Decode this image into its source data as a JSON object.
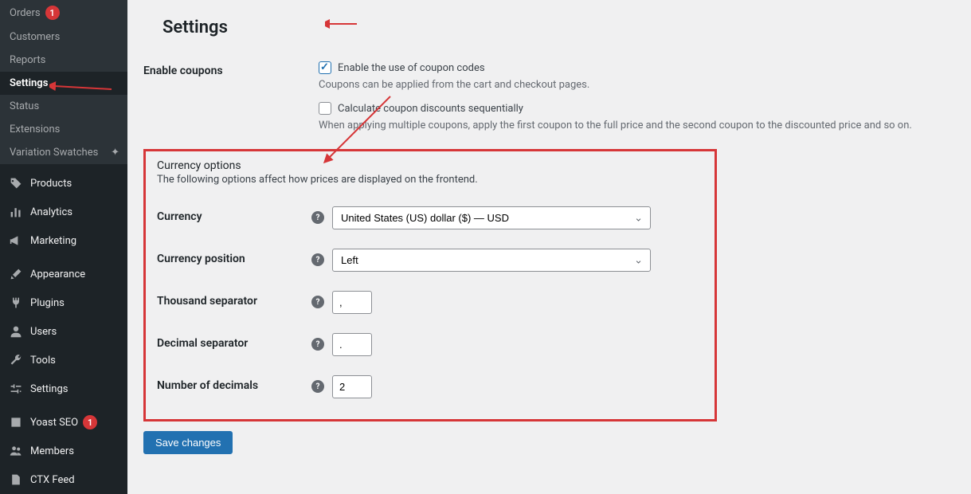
{
  "sidebar": {
    "sub": [
      {
        "label": "Orders",
        "badge": "1"
      },
      {
        "label": "Customers"
      },
      {
        "label": "Reports"
      },
      {
        "label": "Settings",
        "active": true
      },
      {
        "label": "Status"
      },
      {
        "label": "Extensions"
      },
      {
        "label": "Variation Swatches"
      }
    ],
    "main": [
      {
        "label": "Products",
        "icon": "tag"
      },
      {
        "label": "Analytics",
        "icon": "bars"
      },
      {
        "label": "Marketing",
        "icon": "megaphone"
      }
    ],
    "wp": [
      {
        "label": "Appearance",
        "icon": "brush"
      },
      {
        "label": "Plugins",
        "icon": "plug"
      },
      {
        "label": "Users",
        "icon": "user"
      },
      {
        "label": "Tools",
        "icon": "wrench"
      },
      {
        "label": "Settings",
        "icon": "sliders"
      }
    ],
    "extra": [
      {
        "label": "Yoast SEO",
        "icon": "yoast",
        "badge": "1"
      },
      {
        "label": "Members",
        "icon": "people"
      },
      {
        "label": "CTX Feed",
        "icon": "doc"
      }
    ]
  },
  "page": {
    "title": "Settings"
  },
  "coupons": {
    "label": "Enable coupons",
    "enable_label": "Enable the use of coupon codes",
    "enable_desc": "Coupons can be applied from the cart and checkout pages.",
    "seq_label": "Calculate coupon discounts sequentially",
    "seq_desc": "When applying multiple coupons, apply the first coupon to the full price and the second coupon to the discounted price and so on."
  },
  "currency": {
    "section_title": "Currency options",
    "section_desc": "The following options affect how prices are displayed on the frontend.",
    "currency_label": "Currency",
    "currency_value": "United States (US) dollar ($) — USD",
    "position_label": "Currency position",
    "position_value": "Left",
    "thousand_label": "Thousand separator",
    "thousand_value": ",",
    "decimal_label": "Decimal separator",
    "decimal_value": ".",
    "numdec_label": "Number of decimals",
    "numdec_value": "2"
  },
  "buttons": {
    "save": "Save changes"
  }
}
